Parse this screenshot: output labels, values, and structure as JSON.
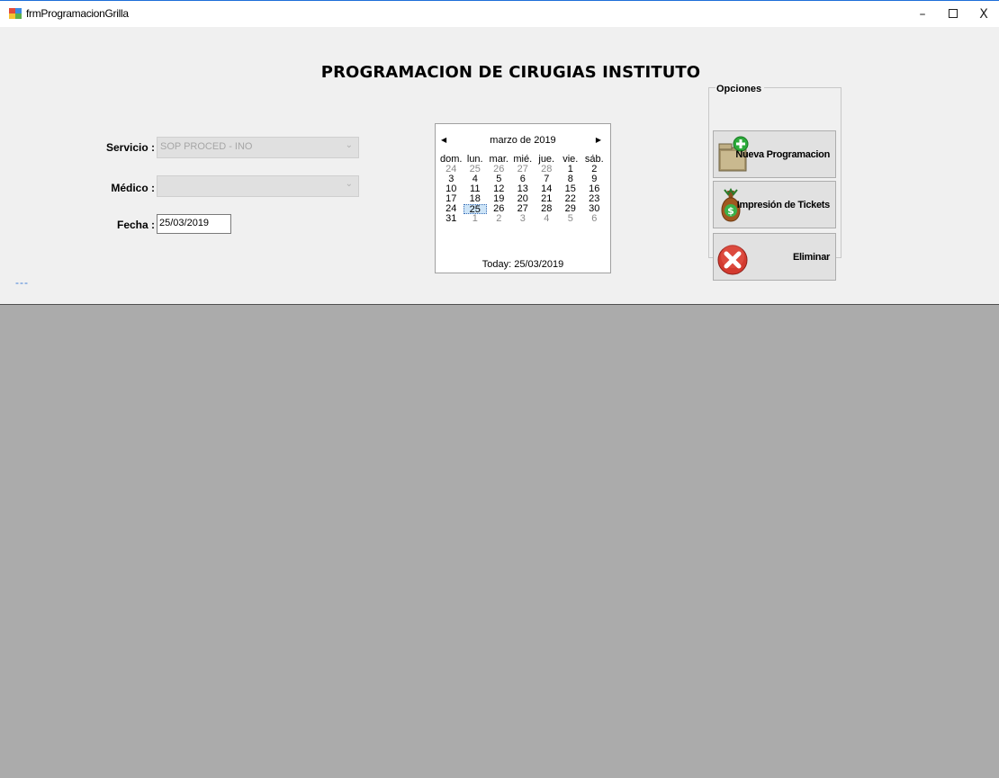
{
  "window": {
    "title": "frmProgramacionGrilla"
  },
  "form": {
    "title": "PROGRAMACION DE CIRUGIAS INSTITUTO",
    "servicio_label": "Servicio :",
    "servicio_value": "SOP PROCED - INO",
    "medico_label": "Médico :",
    "medico_value": "",
    "fecha_label": "Fecha :",
    "fecha_value": "25/03/2019",
    "status_text": "---"
  },
  "calendar": {
    "month_label": "marzo de 2019",
    "weekdays": [
      "dom.",
      "lun.",
      "mar.",
      "mié.",
      "jue.",
      "vie.",
      "sáb."
    ],
    "weeks": [
      [
        "24",
        "25",
        "26",
        "27",
        "28",
        "1",
        "2"
      ],
      [
        "3",
        "4",
        "5",
        "6",
        "7",
        "8",
        "9"
      ],
      [
        "10",
        "11",
        "12",
        "13",
        "14",
        "15",
        "16"
      ],
      [
        "17",
        "18",
        "19",
        "20",
        "21",
        "22",
        "23"
      ],
      [
        "24",
        "25",
        "26",
        "27",
        "28",
        "29",
        "30"
      ],
      [
        "31",
        "1",
        "2",
        "3",
        "4",
        "5",
        "6"
      ]
    ],
    "selected_day": "25",
    "today_label": "Today: 25/03/2019"
  },
  "options": {
    "legend": "Opciones",
    "buttons": [
      {
        "label": "Nueva Programacion",
        "icon": "folder-add-icon"
      },
      {
        "label": "Impresión de Tickets",
        "icon": "money-bag-icon"
      },
      {
        "label": "Eliminar",
        "icon": "delete-x-icon"
      }
    ]
  },
  "colors": {
    "form_bg": "#f0f0f0",
    "grid_bg": "#ababab",
    "accent": "#1e6fd9"
  }
}
